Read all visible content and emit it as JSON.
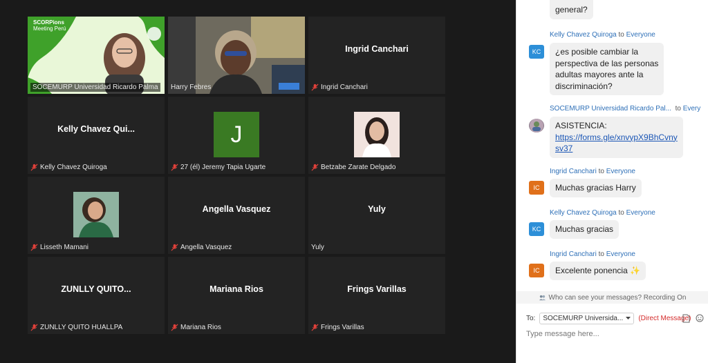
{
  "gallery": {
    "tiles": [
      {
        "name": "SOCEMURP Universidad Ricardo Palma",
        "center": "",
        "muted": false,
        "banner_title": "SCORPions",
        "banner_sub": "Meeting Perú"
      },
      {
        "name": "Harry Febres",
        "center": "",
        "muted": false
      },
      {
        "name": "Ingrid Canchari",
        "center": "Ingrid Canchari",
        "muted": true
      },
      {
        "name": "Kelly Chavez Quiroga",
        "center": "Kelly Chavez Qui...",
        "muted": true
      },
      {
        "name": "27 (él) Jeremy Tapia Ugarte",
        "center": "",
        "avatar_letter": "J",
        "muted": true
      },
      {
        "name": "Betzabe Zarate Delgado",
        "center": "",
        "muted": true
      },
      {
        "name": "Lisseth Mamani",
        "center": "",
        "muted": true
      },
      {
        "name": "Angella Vasquez",
        "center": "Angella Vasquez",
        "muted": true
      },
      {
        "name": "Yuly",
        "center": "Yuly",
        "muted": false
      },
      {
        "name": "ZUNLLY QUITO HUALLPA",
        "center": "ZUNLLY  QUITO...",
        "muted": true
      },
      {
        "name": "Mariana Rios",
        "center": "Mariana Rios",
        "muted": true
      },
      {
        "name": "Frings Varillas",
        "center": "Frings Varillas",
        "muted": true
      }
    ]
  },
  "chat": {
    "messages": [
      {
        "bubble": "general?"
      },
      {
        "sender": "Kelly Chavez Quiroga",
        "to": "to",
        "recipient": "Everyone",
        "initials": "KC",
        "avatar_color": "#2d8fd8",
        "lines": [
          "¿es posible cambiar la",
          "perspectiva de las personas",
          "adultas mayores ante la",
          "discriminación?"
        ]
      },
      {
        "sender": "SOCEMURP Universidad Ricardo Pal...",
        "to": "to",
        "recipient": "Every",
        "lines": [
          "ASISTENCIA:"
        ],
        "link_lines": [
          "https://forms.gle/xnvypX9BhCvny",
          "sv37"
        ]
      },
      {
        "sender": "Ingrid Canchari",
        "to": "to",
        "recipient": "Everyone",
        "initials": "IC",
        "avatar_color": "#e0701a",
        "lines": [
          "Muchas gracias Harry"
        ]
      },
      {
        "sender": "Kelly Chavez Quiroga",
        "to": "to",
        "recipient": "Everyone",
        "initials": "KC",
        "avatar_color": "#2d8fd8",
        "lines": [
          "Muchas gracias"
        ]
      },
      {
        "sender": "Ingrid Canchari",
        "to": "to",
        "recipient": "Everyone",
        "initials": "IC",
        "avatar_color": "#e0701a",
        "lines": [
          "Excelente ponencia"
        ],
        "emoji": "✨"
      }
    ],
    "privacy_note": "Who can see your messages? Recording On",
    "to_label": "To:",
    "to_value": "SOCEMURP Universida...",
    "dm_label": "(Direct Message)",
    "input_placeholder": "Type message here..."
  }
}
